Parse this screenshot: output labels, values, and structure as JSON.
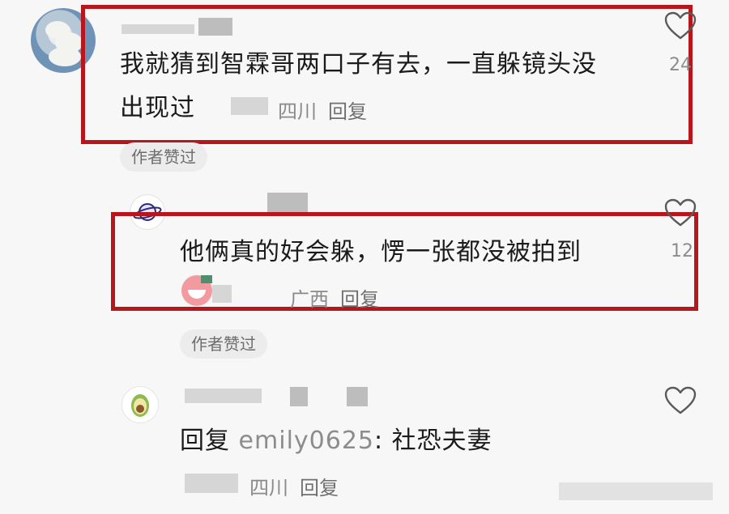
{
  "comments": [
    {
      "text_line1": "我就猜到智霖哥两口子有去，一直躲镜头没",
      "text_line2": "出现过",
      "location": "四川",
      "reply_label": "回复",
      "like_count": "24",
      "author_liked_label": "作者赞过"
    },
    {
      "text": "他俩真的好会躲，愣一张都没被拍到",
      "location": "广西",
      "reply_label": "回复",
      "like_count": "12",
      "author_liked_label": "作者赞过"
    },
    {
      "reply_prefix": "回复",
      "reply_to": "emily0625",
      "reply_text": ": 社恐夫妻",
      "location": "四川",
      "reply_label": "回复"
    }
  ],
  "colors": {
    "highlight_border": "#b7161c",
    "meta_text": "#8a8a8a",
    "background": "#f7f7f7"
  },
  "icons": [
    "heart-outline-icon",
    "avocado-avatar-icon",
    "planet-avatar-icon",
    "laughing-emoji-icon"
  ]
}
